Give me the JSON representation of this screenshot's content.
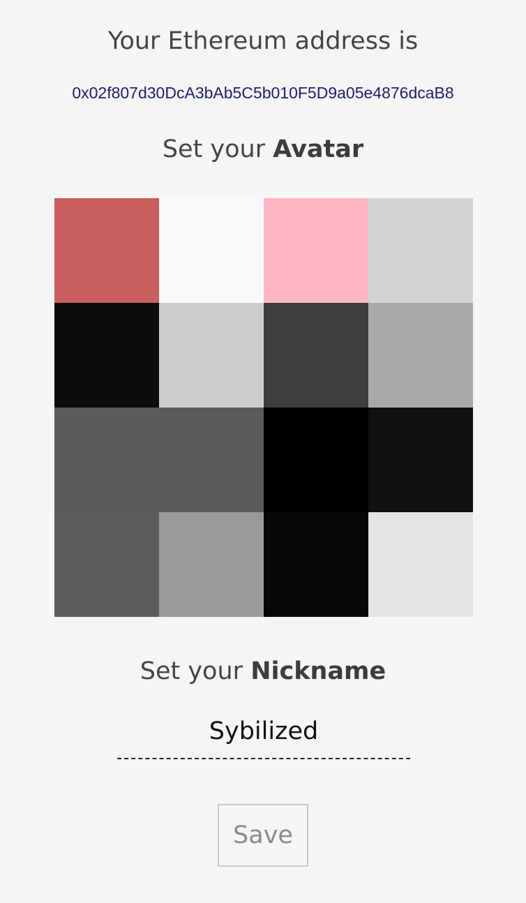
{
  "address_section": {
    "heading": "Your Ethereum address is",
    "address": "0x02f807d30DcA3bAb5C5b010F5D9a05e4876dcaB8"
  },
  "avatar_section": {
    "heading_prefix": "Set your ",
    "heading_bold": "Avatar",
    "cells": [
      "#c95e5e",
      "#f9f9f9",
      "#feb6c2",
      "#d3d3d3",
      "#0d0d0d",
      "#cccccc",
      "#3e3e3e",
      "#a9a9a9",
      "#5b5b5b",
      "#5b5b5b",
      "#000000",
      "#111111",
      "#5d5d5d",
      "#9a9a9a",
      "#070707",
      "#e4e4e4"
    ]
  },
  "nickname_section": {
    "heading_prefix": "Set your ",
    "heading_bold": "Nickname",
    "value": "Sybilized"
  },
  "actions": {
    "save_label": "Save"
  }
}
